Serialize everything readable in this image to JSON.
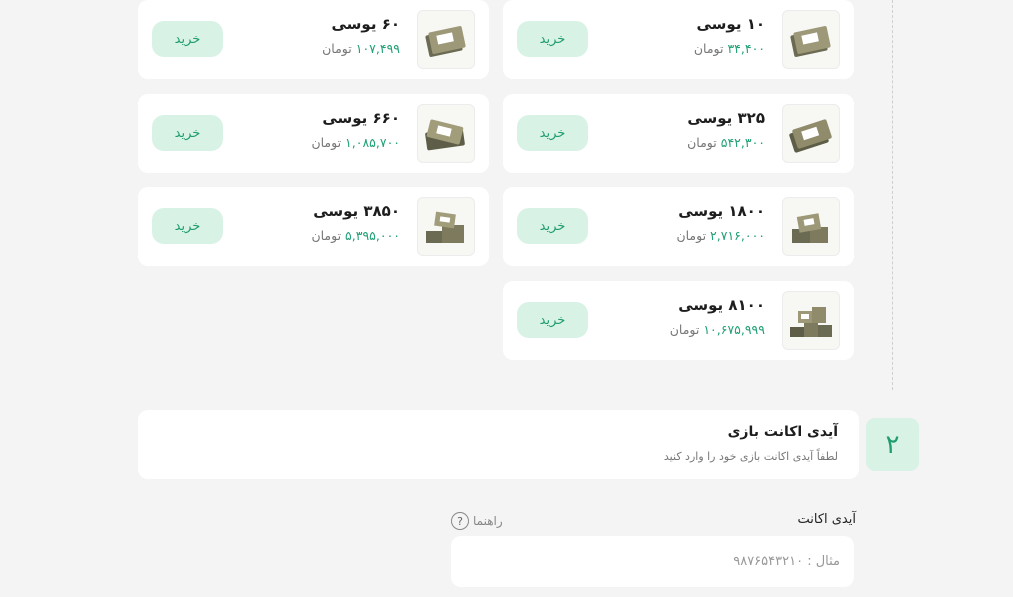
{
  "packs": [
    {
      "title": "۱۰ یوسی",
      "price": "۳۴,۴۰۰",
      "unit": "تومان",
      "buy": "خرید",
      "icon": "uc-banknote-icon"
    },
    {
      "title": "۶۰ یوسی",
      "price": "۱۰۷,۴۹۹",
      "unit": "تومان",
      "buy": "خرید",
      "icon": "uc-banknote-icon"
    },
    {
      "title": "۳۲۵ یوسی",
      "price": "۵۴۲,۳۰۰",
      "unit": "تومان",
      "buy": "خرید",
      "icon": "uc-banknote-icon"
    },
    {
      "title": "۶۶۰ یوسی",
      "price": "۱,۰۸۵,۷۰۰",
      "unit": "تومان",
      "buy": "خرید",
      "icon": "uc-banknote-icon"
    },
    {
      "title": "۱۸۰۰ یوسی",
      "price": "۲,۷۱۶,۰۰۰",
      "unit": "تومان",
      "buy": "خرید",
      "icon": "uc-banknote-icon"
    },
    {
      "title": "۳۸۵۰ یوسی",
      "price": "۵,۳۹۵,۰۰۰",
      "unit": "تومان",
      "buy": "خرید",
      "icon": "uc-banknote-icon"
    },
    {
      "title": "۸۱۰۰ یوسی",
      "price": "۱۰,۶۷۵,۹۹۹",
      "unit": "تومان",
      "buy": "خرید",
      "icon": "uc-banknote-icon"
    }
  ],
  "step": {
    "number": "۲",
    "title": "آیدی اکانت بازی",
    "subtitle": "لطفاً آیدی اکانت بازی خود را وارد کنید"
  },
  "account_field": {
    "label": "آیدی اکانت",
    "help": "راهنما",
    "placeholder": "مثال : ۹۸۷۶۵۴۳۲۱۰"
  },
  "colors": {
    "accent": "#1f9c70",
    "accent_bg": "#d9f2e6",
    "page_bg": "#f4f4f4"
  }
}
